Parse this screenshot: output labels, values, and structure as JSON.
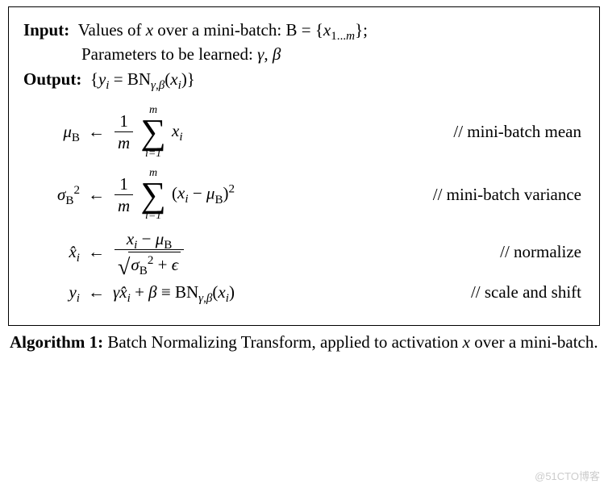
{
  "io": {
    "input_label": "Input:",
    "input_line1_html": "Values of <span class='mi'>x</span> over a mini-batch: <span class='scr'>B</span> = {<span class='mi'>x</span><sub>1...<span class='mi'>m</span></sub>};",
    "input_line2_html": "Parameters to be learned: <span class='mi'>γ</span>, <span class='mi'>β</span>",
    "output_label": "Output:",
    "output_line_html": "{<span class='mi'>y<sub>i</sub></span> = BN<sub><span class='mi'>γ</span>,<span class='mi'>β</span></sub>(<span class='mi'>x<sub>i</sub></span>)}"
  },
  "eqs": [
    {
      "var_html": "<span class='mi'>μ</span><sub><span class='scr'>B</span></sub>",
      "rhs_html": "<span class='frac'><span class='num'>1</span><span class='den mi'>m</span></span> <span class='bigsum'><span class='top'>m</span><span class='sym'>∑</span><span class='bot'>i=1</span></span> <span class='mi'>x<sub>i</sub></span>",
      "comment": "// mini-batch mean"
    },
    {
      "var_html": "<span class='mi'>σ</span><sub><span class='scr'>B</span></sub><sup>2</sup>",
      "rhs_html": "<span class='frac'><span class='num'>1</span><span class='den mi'>m</span></span> <span class='bigsum'><span class='top'>m</span><span class='sym'>∑</span><span class='bot'>i=1</span></span> (<span class='mi'>x<sub>i</sub></span> − <span class='mi'>μ</span><sub><span class='scr'>B</span></sub>)<sup>2</sup>",
      "comment": "// mini-batch variance"
    },
    {
      "var_html": "<span class='mi'>x̂<sub>i</sub></span>",
      "rhs_html": "<span class='frac'><span class='num'><span class='mi'>x<sub>i</sub></span> − <span class='mi'>μ</span><sub><span class='scr'>B</span></sub></span><span class='den'><span class='sqrt'><span class='rad'>√</span><span class='vinc'><span class='mi'>σ</span><sub><span class='scr'>B</span></sub><sup>2</sup> + <span class='mi'>ϵ</span></span></span></span></span>",
      "comment": "// normalize"
    },
    {
      "var_html": "<span class='mi'>y<sub>i</sub></span>",
      "rhs_html": "<span class='mi'>γx̂<sub>i</sub></span> + <span class='mi'>β</span> ≡ BN<sub><span class='mi'>γ</span>,<span class='mi'>β</span></sub>(<span class='mi'>x<sub>i</sub></span>)",
      "comment": "// scale and shift"
    }
  ],
  "caption": {
    "label": "Algorithm 1:",
    "text_html": "Batch Normalizing Transform, applied to activation <span class='mi'>x</span> over a mini-batch."
  },
  "watermark": "@51CTO博客",
  "chart_data": {
    "type": "table",
    "title": "Algorithm 1: Batch Normalizing Transform",
    "input": "Values of x over a mini-batch B = {x_1...m}; parameters to be learned: gamma, beta",
    "output": "{ y_i = BN_{gamma,beta}(x_i) }",
    "steps": [
      {
        "lhs": "mu_B",
        "rhs": "(1/m) * sum_{i=1}^{m} x_i",
        "comment": "mini-batch mean"
      },
      {
        "lhs": "sigma_B^2",
        "rhs": "(1/m) * sum_{i=1}^{m} (x_i - mu_B)^2",
        "comment": "mini-batch variance"
      },
      {
        "lhs": "x_hat_i",
        "rhs": "(x_i - mu_B) / sqrt(sigma_B^2 + epsilon)",
        "comment": "normalize"
      },
      {
        "lhs": "y_i",
        "rhs": "gamma * x_hat_i + beta == BN_{gamma,beta}(x_i)",
        "comment": "scale and shift"
      }
    ]
  }
}
